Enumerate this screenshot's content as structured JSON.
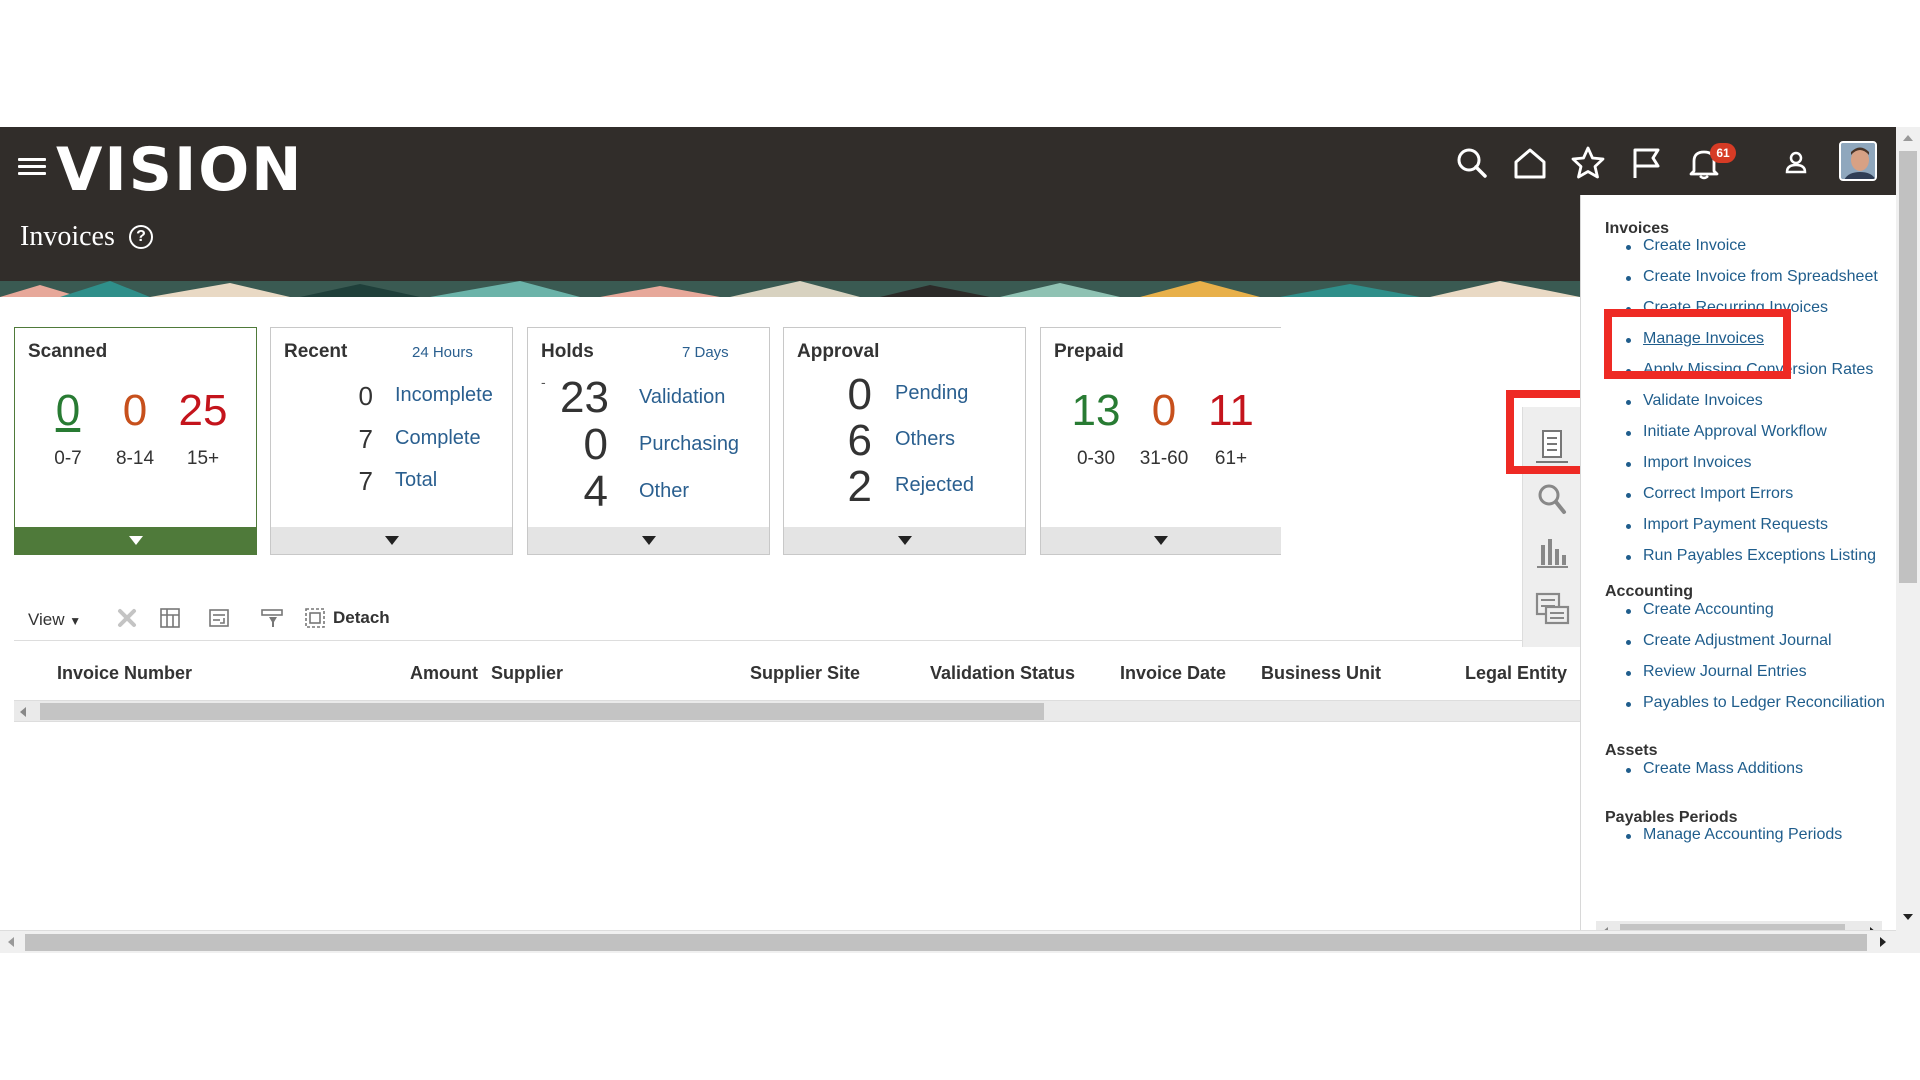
{
  "header": {
    "logo": "VISION",
    "page_title": "Invoices",
    "help_glyph": "?",
    "notification_count": "61",
    "icons": [
      "menu-icon",
      "search-icon",
      "home-icon",
      "star-icon",
      "flag-icon",
      "bell-icon",
      "user-icon"
    ]
  },
  "cards": {
    "scanned": {
      "title": "Scanned",
      "values": [
        "0",
        "0",
        "25"
      ],
      "labels": [
        "0-7",
        "8-14",
        "15+"
      ]
    },
    "recent": {
      "title": "Recent",
      "subtitle": "24 Hours",
      "rows": [
        {
          "num": "0",
          "label": "Incomplete"
        },
        {
          "num": "7",
          "label": "Complete"
        },
        {
          "num": "7",
          "label": "Total"
        }
      ]
    },
    "holds": {
      "title": "Holds",
      "subtitle": "7 Days",
      "dash": "-",
      "rows": [
        {
          "num": "23",
          "label": "Validation"
        },
        {
          "num": "0",
          "label": "Purchasing"
        },
        {
          "num": "4",
          "label": "Other"
        }
      ]
    },
    "approval": {
      "title": "Approval",
      "rows": [
        {
          "num": "0",
          "label": "Pending"
        },
        {
          "num": "6",
          "label": "Others"
        },
        {
          "num": "2",
          "label": "Rejected"
        }
      ]
    },
    "prepaid": {
      "title": "Prepaid",
      "values": [
        "13",
        "0",
        "11"
      ],
      "labels": [
        "0-30",
        "31-60",
        "61+"
      ]
    }
  },
  "toolbar": {
    "view_label": "View",
    "detach_label": "Detach"
  },
  "table": {
    "columns": [
      "Invoice Number",
      "Amount",
      "Supplier",
      "Supplier Site",
      "Validation Status",
      "Invoice Date",
      "Business Unit",
      "Legal Entity"
    ]
  },
  "tasks_panel": {
    "sections": [
      {
        "title": "Invoices",
        "items": [
          "Create Invoice",
          "Create Invoice from Spreadsheet",
          "Create Recurring Invoices",
          "Manage Invoices",
          "Apply Missing Conversion Rates",
          "Validate Invoices",
          "Initiate Approval Workflow",
          "Import Invoices",
          "Correct Import Errors",
          "Import Payment Requests",
          "Run Payables Exceptions Listing"
        ]
      },
      {
        "title": "Accounting",
        "items": [
          "Create Accounting",
          "Create Adjustment Journal",
          "Review Journal Entries",
          "Payables to Ledger Reconciliation"
        ]
      },
      {
        "title": "Assets",
        "items": [
          "Create Mass Additions"
        ]
      },
      {
        "title": "Payables Periods",
        "items": [
          "Manage Accounting Periods"
        ]
      }
    ]
  },
  "colors": {
    "header_bg": "#312d2a",
    "link": "#1f5d8c",
    "green": "#287b33",
    "orange": "#c7501c",
    "red": "#c4141c",
    "highlight": "#ee2a24",
    "badge": "#d63b25"
  }
}
